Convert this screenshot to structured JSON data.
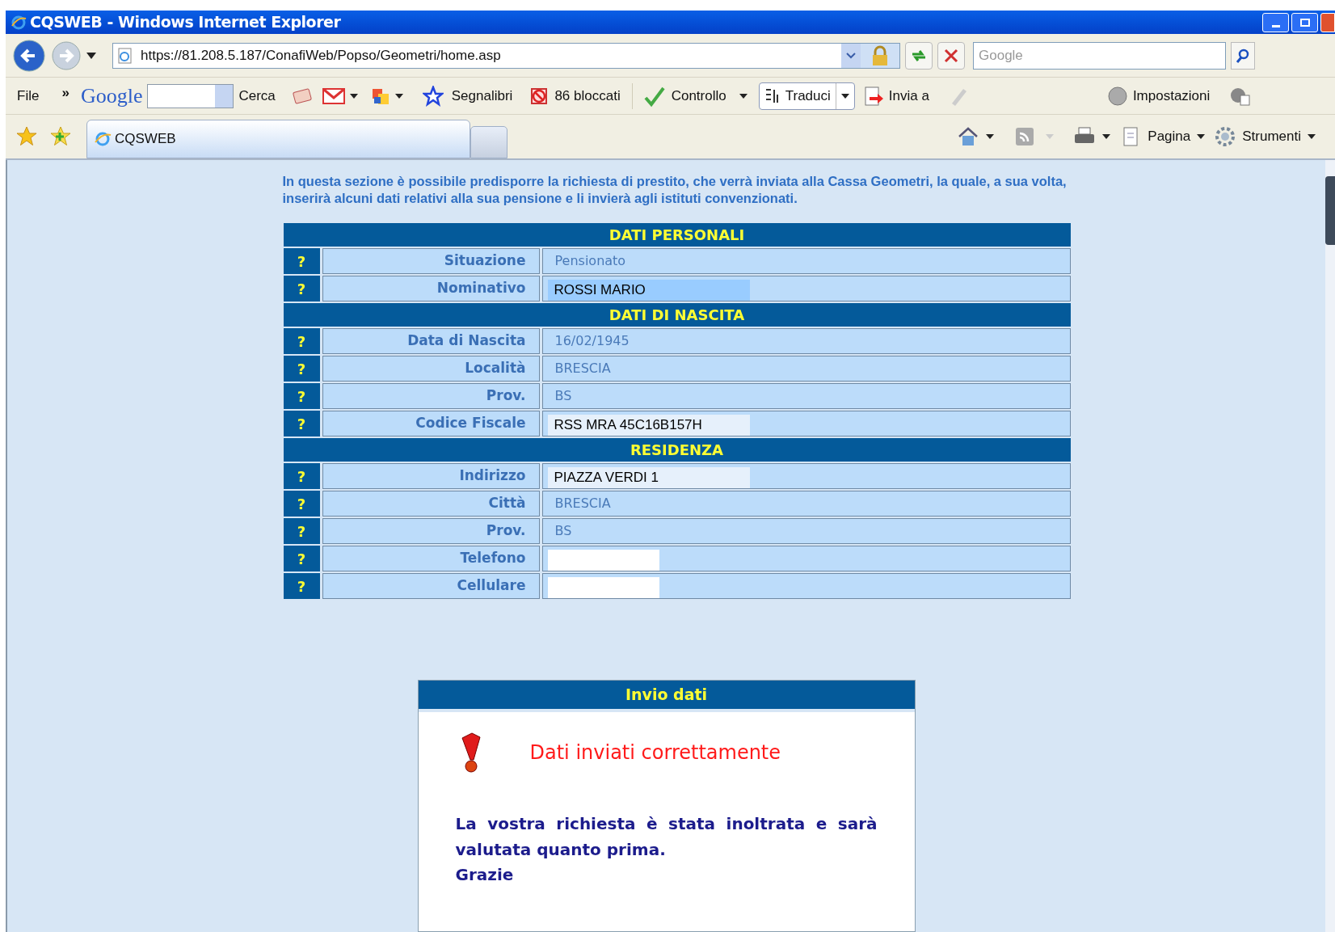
{
  "window": {
    "title": "CQSWEB - Windows Internet Explorer"
  },
  "address_bar": {
    "url": "https://81.208.5.187/ConafiWeb/Popso/Geometri/home.asp",
    "search_placeholder": "Google"
  },
  "google_toolbar": {
    "file_menu": "File",
    "overflow": "»",
    "logo": "Google",
    "search_button": "Cerca",
    "bookmarks": "Segnalibri",
    "blocked": "86 bloccati",
    "spellcheck": "Controllo",
    "translate": "Traduci",
    "send_to": "Invia a",
    "settings": "Impostazioni"
  },
  "tab": {
    "title": "CQSWEB"
  },
  "command_bar": {
    "page": "Pagina",
    "tools": "Strumenti"
  },
  "intro": "In questa sezione è possibile predisporre la richiesta di prestito, che verrà inviata alla Cassa Geometri, la quale, a sua volta, inserirà alcuni dati relativi alla sua pensione e li invierà agli istituti convenzionati.",
  "sections": [
    {
      "title": "DATI PERSONALI",
      "rows": [
        {
          "help": "?",
          "label": "Situazione",
          "kind": "text",
          "value": "Pensionato"
        },
        {
          "help": "?",
          "label": "Nominativo",
          "kind": "input",
          "value": "ROSSI MARIO",
          "focused": true
        }
      ]
    },
    {
      "title": "DATI DI NASCITA",
      "rows": [
        {
          "help": "?",
          "label": "Data di Nascita",
          "kind": "text",
          "value": "16/02/1945"
        },
        {
          "help": "?",
          "label": "Località",
          "kind": "text",
          "value": "BRESCIA"
        },
        {
          "help": "?",
          "label": "Prov.",
          "kind": "text",
          "value": "BS"
        },
        {
          "help": "?",
          "label": "Codice Fiscale",
          "kind": "input",
          "value": "RSS MRA 45C16B157H",
          "focused": false
        }
      ]
    },
    {
      "title": "RESIDENZA",
      "rows": [
        {
          "help": "?",
          "label": "Indirizzo",
          "kind": "input",
          "value": "PIAZZA VERDI 1",
          "focused": false
        },
        {
          "help": "?",
          "label": "Città",
          "kind": "text",
          "value": "BRESCIA"
        },
        {
          "help": "?",
          "label": "Prov.",
          "kind": "text",
          "value": "BS"
        },
        {
          "help": "?",
          "label": "Telefono",
          "kind": "input",
          "focused": false
        },
        {
          "help": "?",
          "label": "Cellulare",
          "kind": "input",
          "focused": false
        }
      ]
    }
  ],
  "result_panel": {
    "title": "Invio dati",
    "message": "Dati inviati correttamente",
    "body": "La vostra richiesta è stata inoltrata e sarà valutata quanto prima.",
    "thanks": "Grazie"
  }
}
